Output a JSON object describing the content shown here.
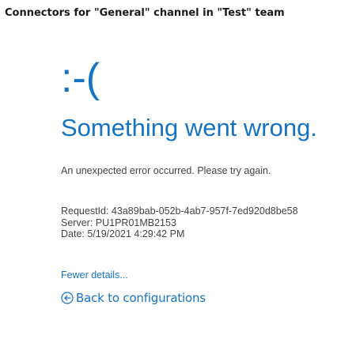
{
  "header": {
    "title": "Connectors for \"General\" channel in \"Test\" team"
  },
  "error": {
    "emoticon": ":-(",
    "heading": "Something went wrong.",
    "message": "An unexpected error occurred. Please try again.",
    "details": {
      "request_id": "RequestId: 43a89bab-052b-4ab7-957f-7ed920d8be58",
      "server": "Server: PU1PR01MB2153",
      "date": "Date: 5/19/2021 4:29:42 PM"
    },
    "fewer_details_label": "Fewer details...",
    "back_label": "Back to configurations"
  },
  "icons": {
    "back": "arrow-left-circle-icon"
  },
  "colors": {
    "accent": "#1673c4",
    "text": "#444444"
  }
}
